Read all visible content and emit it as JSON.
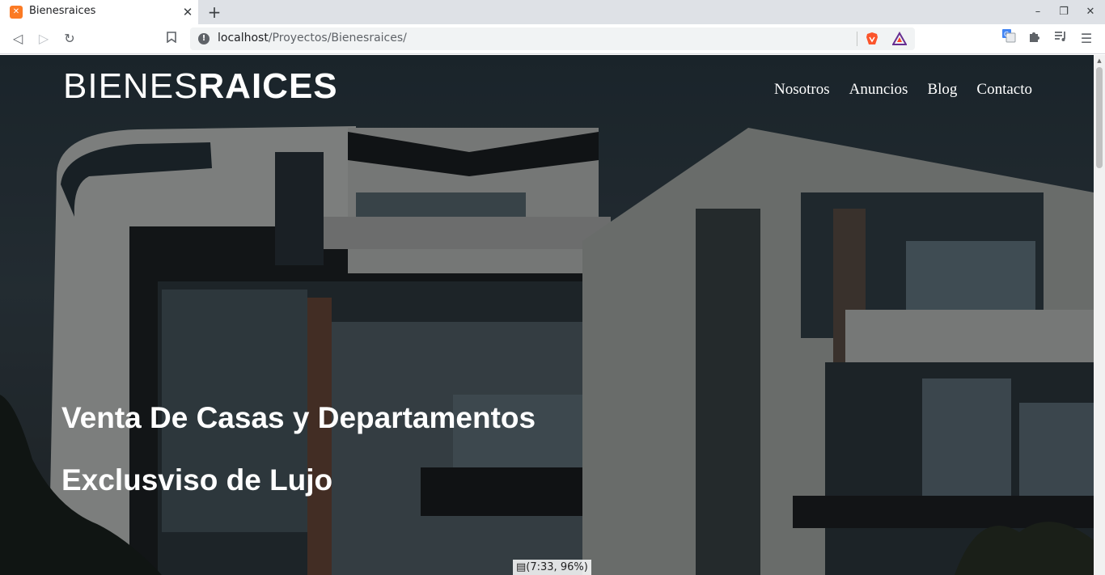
{
  "browser": {
    "tab": {
      "title": "Bienesraices",
      "favicon": "xampp-favicon-icon"
    },
    "url_host": "localhost",
    "url_path": "/Proyectos/Bienesraices/",
    "accent": "#fb7a24"
  },
  "site": {
    "logo_light": "BIENES",
    "logo_bold": "RAICES",
    "nav": [
      "Nosotros",
      "Anuncios",
      "Blog",
      "Contacto"
    ],
    "hero_title": "Venta De Casas y Departamentos",
    "hero_subtitle": "Exclusviso de Lujo"
  },
  "status_overlay": "(7:33, 96%)"
}
